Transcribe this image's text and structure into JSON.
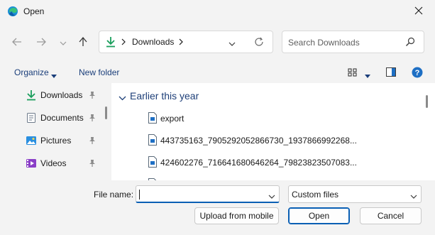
{
  "window": {
    "title": "Open",
    "app_icon": "edge-icon",
    "close_icon": "close-icon"
  },
  "navigation": {
    "back_icon": "arrow-left-icon",
    "forward_icon": "arrow-right-icon",
    "recent_icon": "chevron-down-icon",
    "up_icon": "arrow-up-icon",
    "address": {
      "location_icon": "download-icon",
      "path": "Downloads"
    },
    "refresh_icon": "refresh-icon",
    "search": {
      "placeholder": "Search Downloads",
      "icon": "search-icon"
    }
  },
  "toolbar": {
    "organize_label": "Organize",
    "new_folder_label": "New folder",
    "view_icon": "grid-view-icon",
    "preview_icon": "preview-pane-icon",
    "help_icon": "help-icon"
  },
  "sidebar": {
    "items": [
      {
        "label": "Downloads",
        "icon": "download-icon",
        "pinned": true
      },
      {
        "label": "Documents",
        "icon": "document-icon",
        "pinned": true
      },
      {
        "label": "Pictures",
        "icon": "pictures-icon",
        "pinned": true
      },
      {
        "label": "Videos",
        "icon": "videos-icon",
        "pinned": true
      }
    ]
  },
  "files": {
    "group_title": "Earlier this year",
    "items": [
      {
        "name": "export"
      },
      {
        "name": "443735163_7905292052866730_1937866992268..."
      },
      {
        "name": "424602276_716641680646264_79823823507083..."
      }
    ]
  },
  "footer": {
    "file_name_label": "File name:",
    "file_name_value": "",
    "file_type_selected": "Custom files",
    "upload_label": "Upload from mobile",
    "open_label": "Open",
    "cancel_label": "Cancel"
  },
  "colors": {
    "accent": "#0a5fb4",
    "chrome_bg": "#f3f3f3",
    "group_title": "#1e3f78",
    "download_green": "#1a9e5c"
  }
}
